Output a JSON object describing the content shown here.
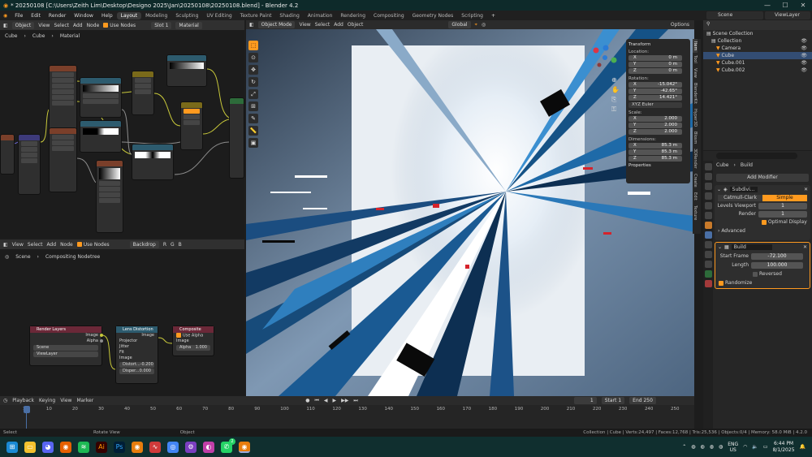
{
  "window": {
    "title": "* 20250108 [C:\\Users\\Zeith Lim\\Desktop\\Designo 2025\\Jan\\20250108\\20250108.blend] - Blender 4.2",
    "minimize": "—",
    "maximize": "☐",
    "close": "✕"
  },
  "menu": {
    "items": [
      "File",
      "Edit",
      "Render",
      "Window",
      "Help"
    ],
    "workspaces": [
      "Layout",
      "Modeling",
      "Sculpting",
      "UV Editing",
      "Texture Paint",
      "Shading",
      "Animation",
      "Rendering",
      "Compositing",
      "Geometry Nodes",
      "Scripting"
    ],
    "active_workspace": "Layout",
    "scene": "Scene",
    "view_layer": "ViewLayer"
  },
  "shader_editor": {
    "header": {
      "mode": "Object",
      "view": "View",
      "select": "Select",
      "add": "Add",
      "node": "Node",
      "use_nodes": "Use Nodes",
      "slot": "Slot 1",
      "material": "Material"
    },
    "breadcrumb": {
      "object": "Cube",
      "mesh": "Cube",
      "material": "Material"
    }
  },
  "compositor": {
    "header": {
      "view": "View",
      "select": "Select",
      "add": "Add",
      "node": "Node",
      "use_nodes": "Use Nodes",
      "backdrop": "Backdrop",
      "channels": [
        "R",
        "G",
        "B"
      ]
    },
    "breadcrumb": {
      "scene": "Scene",
      "tree": "Compositing Nodetree"
    },
    "render_layers": {
      "title": "Render Layers",
      "out_image": "Image",
      "out_alpha": "Alpha",
      "scene": "Scene",
      "view_layer": "ViewLayer"
    },
    "lens_distortion": {
      "title": "Lens Distortion",
      "out_image": "Image",
      "projector": "Projector",
      "jitter": "Jitter",
      "fit": "Fit",
      "in_image": "Image",
      "distort_label": "Distort...",
      "distort_value": "-0.200",
      "dispersion_label": "Disper...",
      "dispersion_value": "0.000"
    },
    "composite": {
      "title": "Composite",
      "use_alpha": "Use Alpha",
      "in_image": "Image",
      "alpha_label": "Alpha",
      "alpha_value": "1.000"
    }
  },
  "viewport": {
    "header": {
      "mode": "Object Mode",
      "view": "View",
      "select": "Select",
      "add": "Add",
      "object": "Object",
      "orientation": "Global",
      "options": "Options"
    },
    "transform": {
      "title": "Transform",
      "location_label": "Location:",
      "location": {
        "X": "0 m",
        "Y": "0 m",
        "Z": "0 m"
      },
      "rotation_label": "Rotation:",
      "rotation": {
        "X": "-15.042°",
        "Y": "-42.65°",
        "Z": "14.421°"
      },
      "rotation_mode": "XYZ Euler",
      "scale_label": "Scale:",
      "scale": {
        "X": "2.000",
        "Y": "2.000",
        "Z": "2.000"
      },
      "dimensions_label": "Dimensions:",
      "dimensions": {
        "X": "85.3 m",
        "Y": "85.3 m",
        "Z": "85.3 m"
      },
      "properties": "Properties"
    },
    "side_tabs": [
      "Item",
      "Tool",
      "View",
      "BlenderKit",
      "Hyper3D",
      "Blosm",
      "3DRender",
      "Create",
      "Edit",
      "Texture"
    ]
  },
  "outliner": {
    "root": "Scene Collection",
    "items": [
      {
        "label": "Collection"
      },
      {
        "label": "Camera"
      },
      {
        "label": "Cube"
      },
      {
        "label": "Cube.001"
      },
      {
        "label": "Cube.002"
      }
    ]
  },
  "properties": {
    "breadcrumb": {
      "object": "Cube",
      "modifier": "Build"
    },
    "add_modifier": "Add Modifier",
    "subdivision": {
      "name": "Subdivi...",
      "catmull": "Catmull-Clark",
      "simple": "Simple",
      "levels_viewport_label": "Levels Viewport",
      "levels_viewport": "1",
      "render_label": "Render",
      "render": "1",
      "optimal_display": "Optimal Display",
      "advanced": "Advanced"
    },
    "build": {
      "name": "Build",
      "start_frame_label": "Start Frame",
      "start_frame": "-72.100",
      "length_label": "Length",
      "length": "100.000",
      "reversed": "Reversed",
      "randomize": "Randomize"
    }
  },
  "timeline": {
    "header": {
      "playback": "Playback",
      "keying": "Keying",
      "view": "View",
      "marker": "Marker"
    },
    "current_frame": "1",
    "start_label": "Start",
    "start": "1",
    "end_label": "End",
    "end": "250",
    "ticks": [
      "1",
      "10",
      "20",
      "30",
      "40",
      "50",
      "60",
      "70",
      "80",
      "90",
      "100",
      "110",
      "120",
      "130",
      "140",
      "150",
      "160",
      "170",
      "180",
      "190",
      "200",
      "210",
      "220",
      "230",
      "240",
      "250"
    ]
  },
  "statusbar": {
    "select": "Select",
    "rotate": "Rotate View",
    "object": "Object",
    "stats": "Collection | Cube | Verts:24,497 | Faces:12,768 | Tris:25,536 | Objects:0/4 | Memory: 58.0 MiB | 4.2.0"
  },
  "taskbar": {
    "icons": [
      "windows-start",
      "file-explorer",
      "discord",
      "firefox",
      "spotify",
      "illustrator",
      "photoshop",
      "blender-legacy",
      "app-chart",
      "chrome",
      "app-settings",
      "app-gradient",
      "whatsapp",
      "blender"
    ],
    "whatsapp_badge": "2",
    "language": "ENG",
    "region": "US",
    "time": "6:44 PM",
    "date": "8/1/2025"
  },
  "colors": {
    "accent": "#ff9a1f",
    "selected_blue": "#4a6fa5",
    "title_bg": "#0e2a2a"
  }
}
